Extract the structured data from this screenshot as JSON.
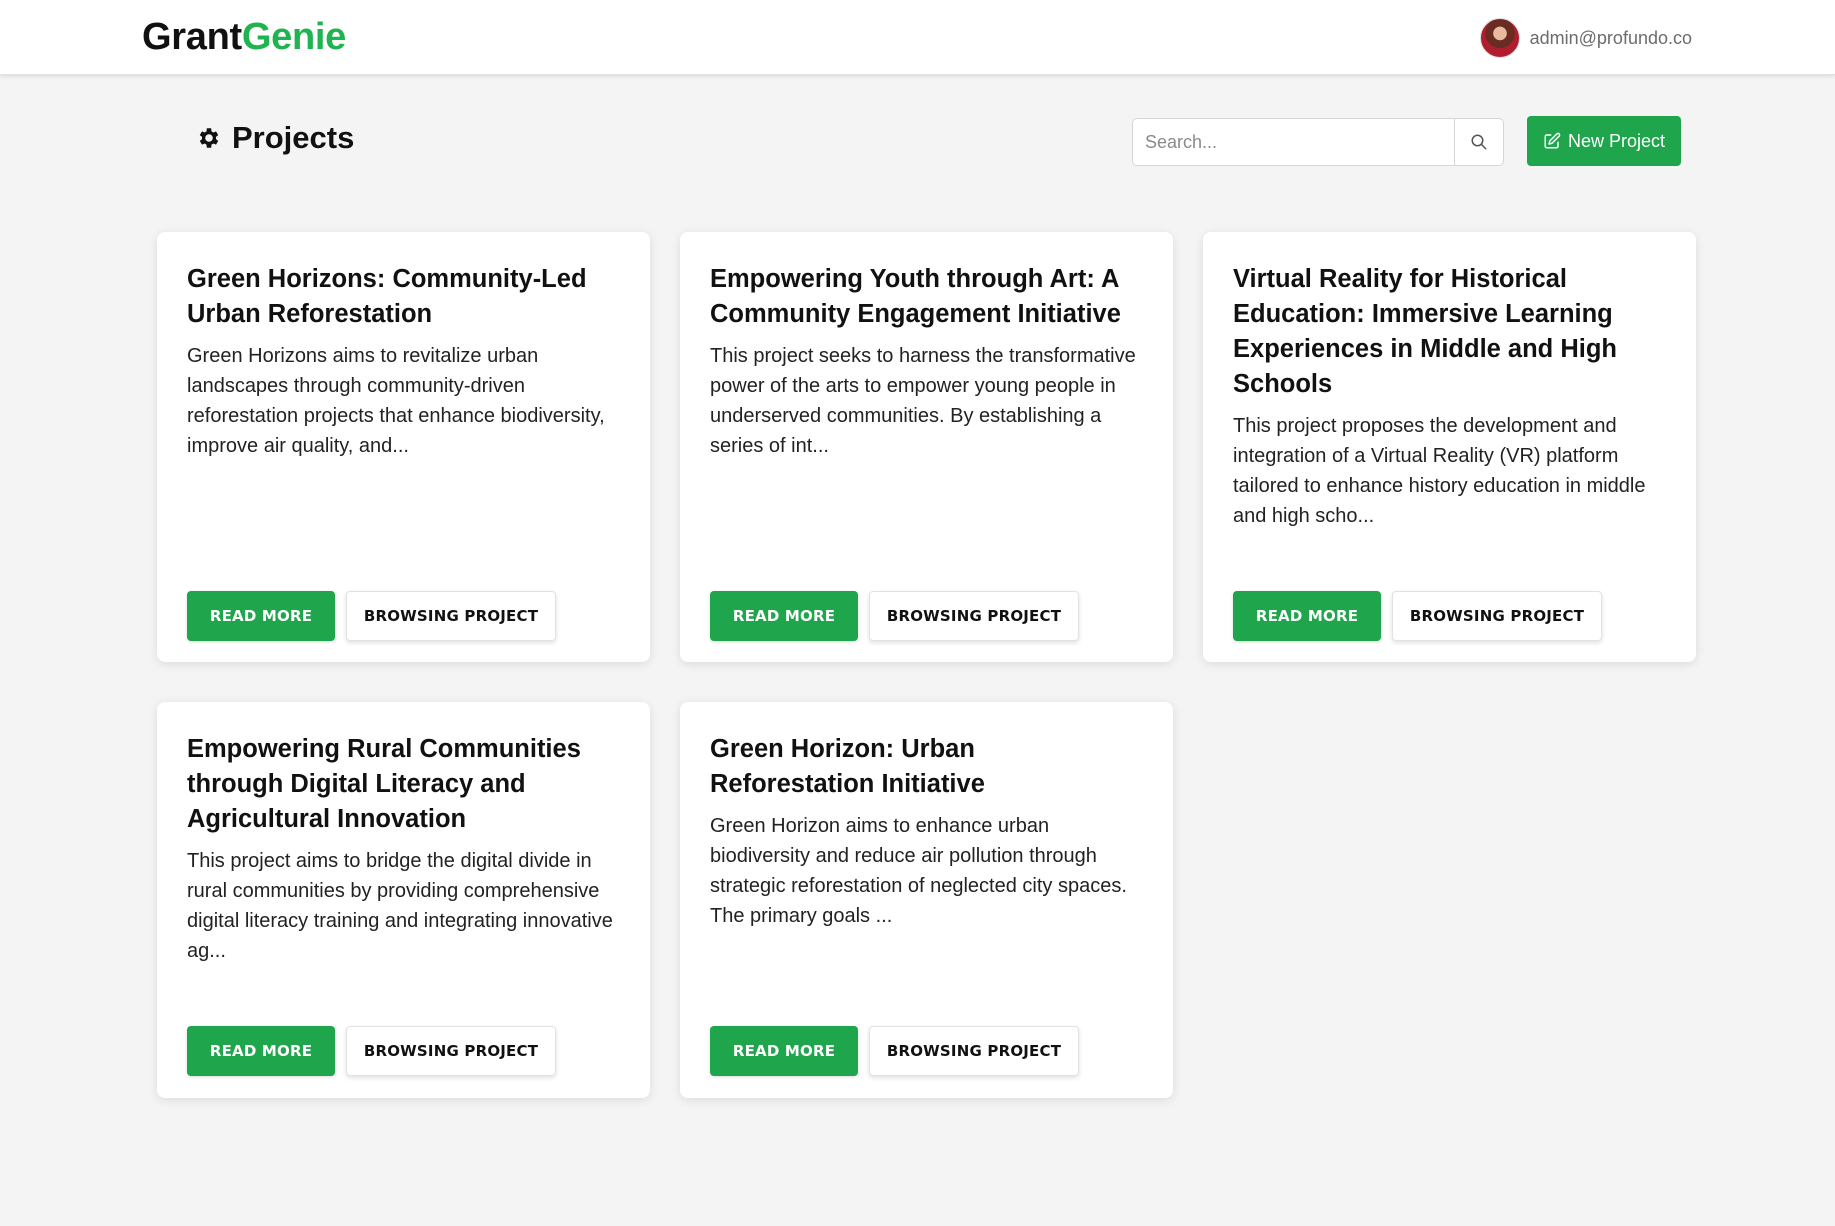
{
  "header": {
    "brand_part1": "Grant",
    "brand_part2": "Genie",
    "user_email": "admin@profundo.co"
  },
  "toolbar": {
    "page_title": "Projects",
    "search_placeholder": "Search...",
    "new_project_label": "New Project"
  },
  "colors": {
    "accent": "#1fa64d",
    "brand_green": "#1fb450",
    "background": "#f4f4f4"
  },
  "projects": [
    {
      "title": "Green Horizons: Community-Led Urban Reforestation",
      "description": "Green Horizons aims to revitalize urban landscapes through community-driven reforestation projects that enhance biodiversity, improve air quality, and...",
      "read_more_label": "READ MORE",
      "browse_label": "BROWSING PROJECT"
    },
    {
      "title": "Empowering Youth through Art: A Community Engagement Initiative",
      "description": "This project seeks to harness the transformative power of the arts to empower young people in underserved communities. By establishing a series of int...",
      "read_more_label": "READ MORE",
      "browse_label": "BROWSING PROJECT"
    },
    {
      "title": "Virtual Reality for Historical Education: Immersive Learning Experiences in Middle and High Schools",
      "description": "This project proposes the development and integration of a Virtual Reality (VR) platform tailored to enhance history education in middle and high scho...",
      "read_more_label": "READ MORE",
      "browse_label": "BROWSING PROJECT"
    },
    {
      "title": "Empowering Rural Communities through Digital Literacy and Agricultural Innovation",
      "description": "This project aims to bridge the digital divide in rural communities by providing comprehensive digital literacy training and integrating innovative ag...",
      "read_more_label": "READ MORE",
      "browse_label": "BROWSING PROJECT"
    },
    {
      "title": "Green Horizon: Urban Reforestation Initiative",
      "description": "Green Horizon aims to enhance urban biodiversity and reduce air pollution through strategic reforestation of neglected city spaces. The primary goals ...",
      "read_more_label": "READ MORE",
      "browse_label": "BROWSING PROJECT"
    }
  ]
}
